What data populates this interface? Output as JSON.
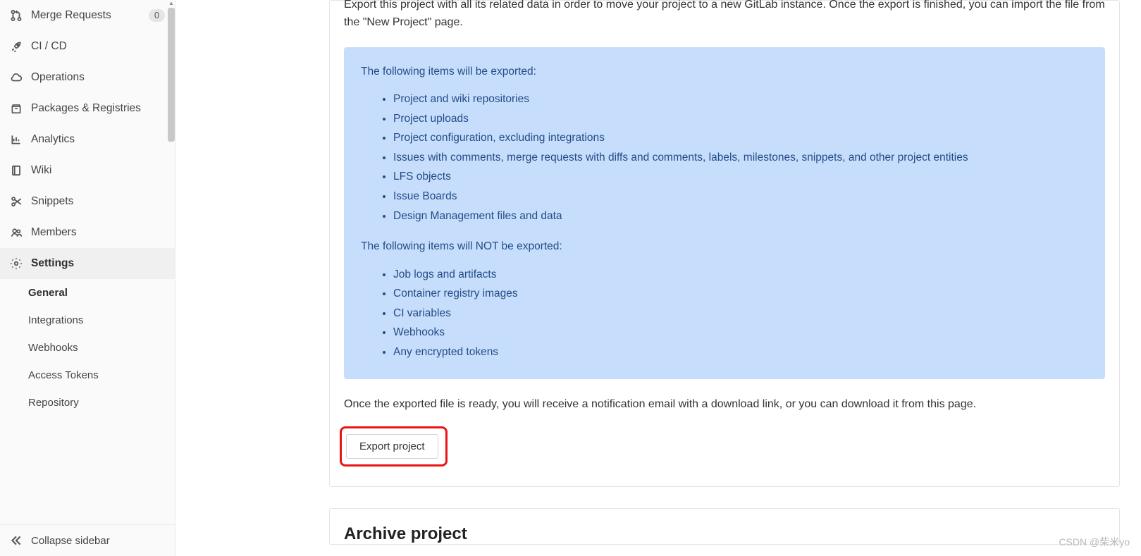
{
  "sidebar": {
    "items": [
      {
        "label": "Merge Requests",
        "badge": "0"
      },
      {
        "label": "CI / CD"
      },
      {
        "label": "Operations"
      },
      {
        "label": "Packages & Registries"
      },
      {
        "label": "Analytics"
      },
      {
        "label": "Wiki"
      },
      {
        "label": "Snippets"
      },
      {
        "label": "Members"
      },
      {
        "label": "Settings"
      }
    ],
    "settings_sub": [
      {
        "label": "General"
      },
      {
        "label": "Integrations"
      },
      {
        "label": "Webhooks"
      },
      {
        "label": "Access Tokens"
      },
      {
        "label": "Repository"
      }
    ],
    "collapse_label": "Collapse sidebar"
  },
  "export": {
    "intro": "Export this project with all its related data in order to move your project to a new GitLab instance. Once the export is finished, you can import the file from the \"New Project\" page.",
    "exported_heading": "The following items will be exported:",
    "exported_items": [
      "Project and wiki repositories",
      "Project uploads",
      "Project configuration, excluding integrations",
      "Issues with comments, merge requests with diffs and comments, labels, milestones, snippets, and other project entities",
      "LFS objects",
      "Issue Boards",
      "Design Management files and data"
    ],
    "not_exported_heading": "The following items will NOT be exported:",
    "not_exported_items": [
      "Job logs and artifacts",
      "Container registry images",
      "CI variables",
      "Webhooks",
      "Any encrypted tokens"
    ],
    "ready_note": "Once the exported file is ready, you will receive a notification email with a download link, or you can download it from this page.",
    "button_label": "Export project"
  },
  "archive": {
    "heading": "Archive project"
  },
  "watermark": "CSDN @柴米yo"
}
